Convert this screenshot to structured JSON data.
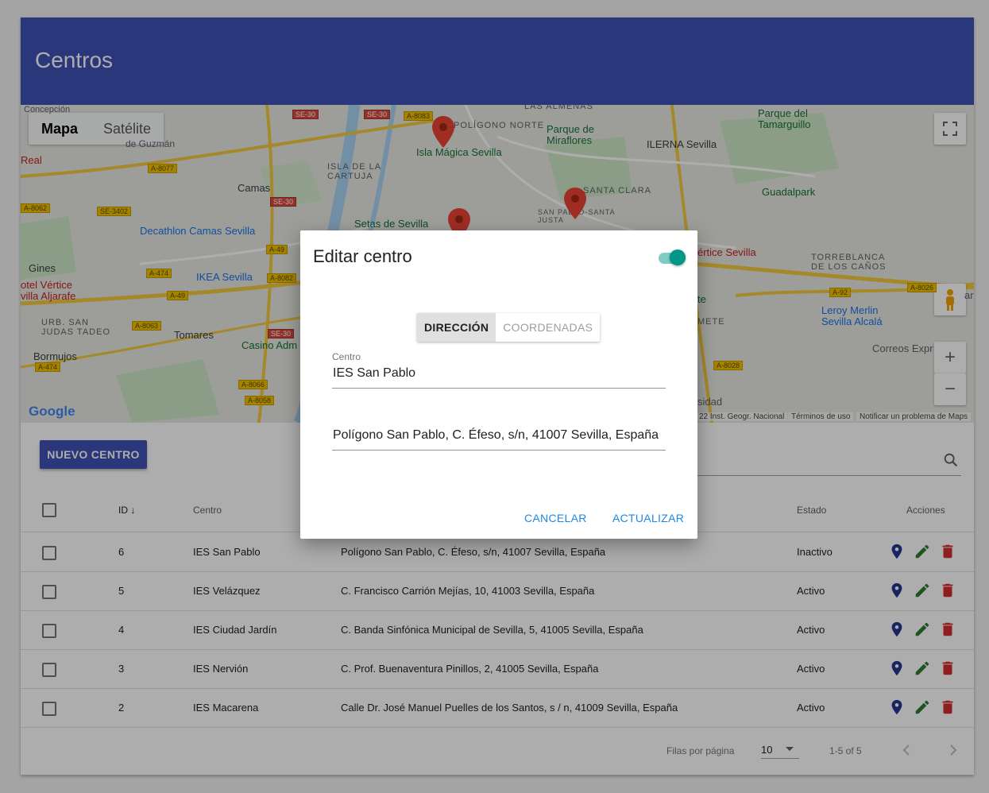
{
  "header": {
    "title": "Centros"
  },
  "map": {
    "type_buttons": [
      "Mapa",
      "Satélite"
    ],
    "labels": {
      "poligono_norte": "POLÍGONO NORTE",
      "isla_magica": "Isla Mágica Sevilla",
      "parque_miraflores": "Parque de Miraflores",
      "ilerna": "ILERNA Sevilla",
      "parque_tamarguillo": "Parque del Tamarguillo",
      "isla_cartuja": "ISLA DE LA CARTUJA",
      "camas": "Camas",
      "santa_clara": "SANTA CLARA",
      "san_pablo_justa": "SAN PABLO-SANTA JUSTA",
      "guadalpark": "Guadalpark",
      "decathlon": "Decathlon Camas Sevilla",
      "setas": "Setas de Sevilla",
      "ikea": "IKEA Sevilla",
      "gines": "Gines",
      "hotel_vertice_aljarafe": "otel Vértice villa Aljarafe",
      "vertice_sevilla": "értice Sevilla",
      "torreblanca": "TORREBLANCA DE LOS CAÑOS",
      "urb_san_judas": "URB. SAN JUDAS TADEO",
      "tomares": "Tomares",
      "casino": "Casino Adm",
      "leroy": "Leroy Merlin Sevilla Alcalá",
      "bormujos": "Bormujos",
      "correos": "Correos Expr",
      "real": "Real",
      "concepcion": "Concepción",
      "guzman": "de Guzmán",
      "almenas": "LAS ALMENAS",
      "armete": "METE",
      "sidad": "sidad",
      "ar": "ar",
      "te": "te"
    },
    "roads": [
      "SE-30",
      "SE-30",
      "A-8083",
      "A-8077",
      "A-8062",
      "SE-3402",
      "SE-30",
      "A-49",
      "A-474",
      "A-8082",
      "A-49",
      "A-8063",
      "SE-30",
      "A-474",
      "A-8066",
      "A-8058",
      "A-8026",
      "A-92",
      "A-8028"
    ],
    "footer": {
      "copyright": "22 Inst. Geogr. Nacional",
      "terms": "Términos de uso",
      "report": "Notificar un problema de Maps"
    },
    "logo": "Google"
  },
  "toolbar": {
    "new_button": "NUEVO CENTRO"
  },
  "table": {
    "headers": {
      "id": "ID",
      "centro": "Centro",
      "estado": "Estado",
      "acciones": "Acciones"
    },
    "rows": [
      {
        "id": "6",
        "centro": "IES San Pablo",
        "direccion": "Polígono San Pablo, C. Éfeso, s/n, 41007 Sevilla, España",
        "estado": "Inactivo"
      },
      {
        "id": "5",
        "centro": "IES Velázquez",
        "direccion": "C. Francisco Carrión Mejías, 10, 41003 Sevilla, España",
        "estado": "Activo"
      },
      {
        "id": "4",
        "centro": "IES Ciudad Jardín",
        "direccion": "C. Banda Sinfónica Municipal de Sevilla, 5, 41005 Sevilla, España",
        "estado": "Activo"
      },
      {
        "id": "3",
        "centro": "IES Nervión",
        "direccion": "C. Prof. Buenaventura Pinillos, 2, 41005 Sevilla, España",
        "estado": "Activo"
      },
      {
        "id": "2",
        "centro": "IES Macarena",
        "direccion": "Calle Dr. José Manuel Puelles de los Santos, s / n, 41009 Sevilla, España",
        "estado": "Activo"
      }
    ]
  },
  "pagination": {
    "rows_label": "Filas por página",
    "rows_value": "10",
    "range": "1-5 of 5"
  },
  "dialog": {
    "title": "Editar centro",
    "toggle_on": true,
    "tabs": {
      "direccion": "DIRECCIÓN",
      "coordenadas": "COORDENADAS"
    },
    "centro_label": "Centro",
    "centro_value": "IES San Pablo",
    "direccion_value": "Polígono San Pablo, C. Éfeso, s/n, 41007 Sevilla, España",
    "cancel": "CANCELAR",
    "update": "ACTUALIZAR"
  },
  "colors": {
    "primary": "#3f51b5",
    "accent": "#009688",
    "action_blue": "#1e88e5",
    "delete_red": "#d32f2f",
    "edit_green": "#2e7d32",
    "pin_indigo": "#283593"
  }
}
